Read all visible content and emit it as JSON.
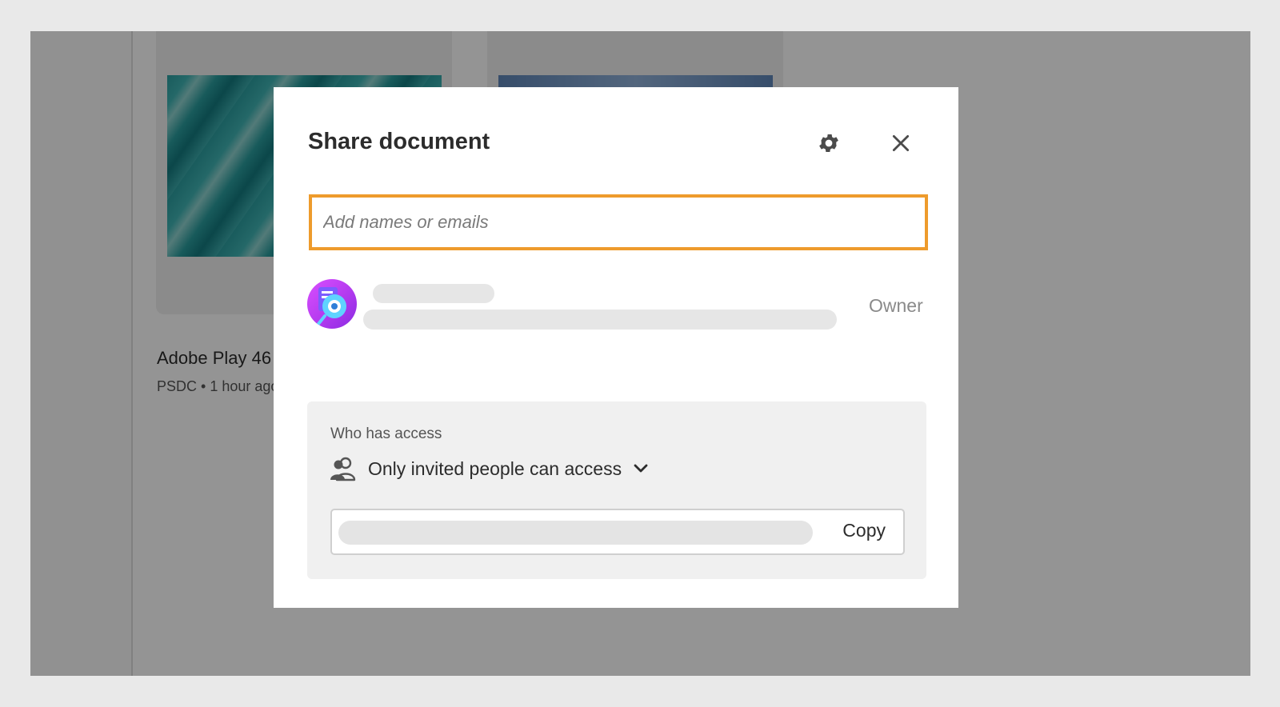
{
  "background": {
    "document_card": {
      "title": "Adobe Play 46",
      "meta": "PSDC • 1 hour ago"
    }
  },
  "dialog": {
    "title": "Share document",
    "settings_icon": "gear-icon",
    "close_icon": "close-icon",
    "invite_input": {
      "value": "",
      "placeholder": "Add names or emails"
    },
    "owner": {
      "role": "Owner",
      "avatar_icon": "app-avatar-icon"
    },
    "access": {
      "label": "Who has access",
      "icon": "people-icon",
      "selected_option": "Only invited people can access",
      "chevron_icon": "chevron-down-icon"
    },
    "link": {
      "copy_label": "Copy"
    }
  },
  "colors": {
    "highlight_border": "#ee9b2c",
    "avatar": "#c446f5"
  }
}
